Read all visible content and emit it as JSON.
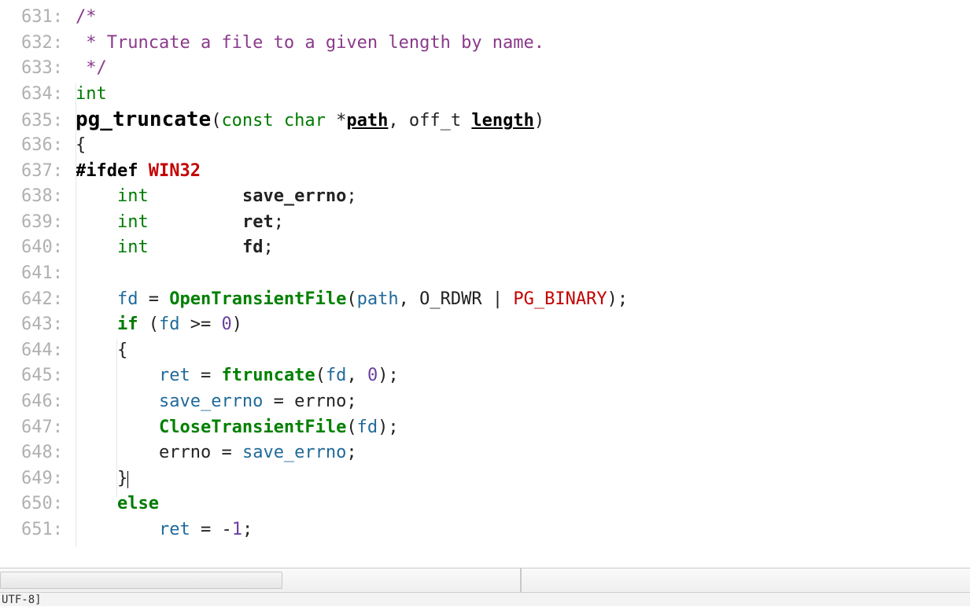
{
  "editor": {
    "first_line_number": 631,
    "encoding_status": "UTF-8]",
    "cursor_line_index": 18,
    "lines": [
      {
        "n": "631",
        "tokens": [
          {
            "cls": "c-comment",
            "t": "/*"
          }
        ]
      },
      {
        "n": "632",
        "tokens": [
          {
            "cls": "c-comment",
            "t": " * Truncate a file to a given length by name."
          }
        ]
      },
      {
        "n": "633",
        "tokens": [
          {
            "cls": "c-comment",
            "t": " */"
          }
        ]
      },
      {
        "n": "634",
        "tokens": [
          {
            "cls": "c-keyword-plain",
            "t": "int"
          }
        ]
      },
      {
        "n": "635",
        "tokens": [
          {
            "cls": "c-funcdef",
            "t": "pg_truncate"
          },
          {
            "cls": "c-brace",
            "t": "("
          },
          {
            "cls": "c-keyword-plain",
            "t": "const"
          },
          {
            "cls": "",
            "t": " "
          },
          {
            "cls": "c-keyword-plain",
            "t": "char"
          },
          {
            "cls": "",
            "t": " "
          },
          {
            "cls": "c-op",
            "t": "*"
          },
          {
            "cls": "c-param",
            "t": "path"
          },
          {
            "cls": "c-op",
            "t": ","
          },
          {
            "cls": "",
            "t": " "
          },
          {
            "cls": "c-ident",
            "t": "off_t"
          },
          {
            "cls": "",
            "t": " "
          },
          {
            "cls": "c-param",
            "t": "length"
          },
          {
            "cls": "c-brace",
            "t": ")"
          }
        ]
      },
      {
        "n": "636",
        "tokens": [
          {
            "cls": "c-brace",
            "t": "{"
          }
        ]
      },
      {
        "n": "637",
        "tokens": [
          {
            "cls": "c-preproc",
            "t": "#ifdef"
          },
          {
            "cls": "",
            "t": " "
          },
          {
            "cls": "c-preproc-id",
            "t": "WIN32"
          }
        ]
      },
      {
        "n": "638",
        "tokens": [
          {
            "cls": "",
            "t": "    "
          },
          {
            "cls": "c-keyword-plain",
            "t": "int"
          },
          {
            "cls": "",
            "t": "         "
          },
          {
            "cls": "c-var-bold",
            "t": "save_errno"
          },
          {
            "cls": "c-op",
            "t": ";"
          }
        ]
      },
      {
        "n": "639",
        "tokens": [
          {
            "cls": "",
            "t": "    "
          },
          {
            "cls": "c-keyword-plain",
            "t": "int"
          },
          {
            "cls": "",
            "t": "         "
          },
          {
            "cls": "c-var-bold",
            "t": "ret"
          },
          {
            "cls": "c-op",
            "t": ";"
          }
        ]
      },
      {
        "n": "640",
        "tokens": [
          {
            "cls": "",
            "t": "    "
          },
          {
            "cls": "c-keyword-plain",
            "t": "int"
          },
          {
            "cls": "",
            "t": "         "
          },
          {
            "cls": "c-var-bold",
            "t": "fd"
          },
          {
            "cls": "c-op",
            "t": ";"
          }
        ]
      },
      {
        "n": "641",
        "tokens": []
      },
      {
        "n": "642",
        "tokens": [
          {
            "cls": "",
            "t": "    "
          },
          {
            "cls": "c-var",
            "t": "fd"
          },
          {
            "cls": "",
            "t": " "
          },
          {
            "cls": "c-op",
            "t": "="
          },
          {
            "cls": "",
            "t": " "
          },
          {
            "cls": "c-funcname",
            "t": "OpenTransientFile"
          },
          {
            "cls": "c-brace",
            "t": "("
          },
          {
            "cls": "c-var",
            "t": "path"
          },
          {
            "cls": "c-op",
            "t": ","
          },
          {
            "cls": "",
            "t": " "
          },
          {
            "cls": "c-ident",
            "t": "O_RDWR"
          },
          {
            "cls": "",
            "t": " "
          },
          {
            "cls": "c-op",
            "t": "|"
          },
          {
            "cls": "",
            "t": " "
          },
          {
            "cls": "c-macro",
            "t": "PG_BINARY"
          },
          {
            "cls": "c-brace",
            "t": ")"
          },
          {
            "cls": "c-op",
            "t": ";"
          }
        ]
      },
      {
        "n": "643",
        "tokens": [
          {
            "cls": "",
            "t": "    "
          },
          {
            "cls": "c-keyword",
            "t": "if"
          },
          {
            "cls": "",
            "t": " "
          },
          {
            "cls": "c-brace",
            "t": "("
          },
          {
            "cls": "c-var",
            "t": "fd"
          },
          {
            "cls": "",
            "t": " "
          },
          {
            "cls": "c-op",
            "t": ">="
          },
          {
            "cls": "",
            "t": " "
          },
          {
            "cls": "c-number",
            "t": "0"
          },
          {
            "cls": "c-brace",
            "t": ")"
          }
        ]
      },
      {
        "n": "644",
        "tokens": [
          {
            "cls": "",
            "t": "    "
          },
          {
            "cls": "c-brace",
            "t": "{"
          }
        ]
      },
      {
        "n": "645",
        "tokens": [
          {
            "cls": "",
            "t": "        "
          },
          {
            "cls": "c-var",
            "t": "ret"
          },
          {
            "cls": "",
            "t": " "
          },
          {
            "cls": "c-op",
            "t": "="
          },
          {
            "cls": "",
            "t": " "
          },
          {
            "cls": "c-funcname",
            "t": "ftruncate"
          },
          {
            "cls": "c-brace",
            "t": "("
          },
          {
            "cls": "c-var",
            "t": "fd"
          },
          {
            "cls": "c-op",
            "t": ","
          },
          {
            "cls": "",
            "t": " "
          },
          {
            "cls": "c-number",
            "t": "0"
          },
          {
            "cls": "c-brace",
            "t": ")"
          },
          {
            "cls": "c-op",
            "t": ";"
          }
        ]
      },
      {
        "n": "646",
        "tokens": [
          {
            "cls": "",
            "t": "        "
          },
          {
            "cls": "c-var",
            "t": "save_errno"
          },
          {
            "cls": "",
            "t": " "
          },
          {
            "cls": "c-op",
            "t": "="
          },
          {
            "cls": "",
            "t": " "
          },
          {
            "cls": "c-ident",
            "t": "errno"
          },
          {
            "cls": "c-op",
            "t": ";"
          }
        ]
      },
      {
        "n": "647",
        "tokens": [
          {
            "cls": "",
            "t": "        "
          },
          {
            "cls": "c-funcname",
            "t": "CloseTransientFile"
          },
          {
            "cls": "c-brace",
            "t": "("
          },
          {
            "cls": "c-var",
            "t": "fd"
          },
          {
            "cls": "c-brace",
            "t": ")"
          },
          {
            "cls": "c-op",
            "t": ";"
          }
        ]
      },
      {
        "n": "648",
        "tokens": [
          {
            "cls": "",
            "t": "        "
          },
          {
            "cls": "c-ident",
            "t": "errno"
          },
          {
            "cls": "",
            "t": " "
          },
          {
            "cls": "c-op",
            "t": "="
          },
          {
            "cls": "",
            "t": " "
          },
          {
            "cls": "c-var",
            "t": "save_errno"
          },
          {
            "cls": "c-op",
            "t": ";"
          }
        ]
      },
      {
        "n": "649",
        "tokens": [
          {
            "cls": "",
            "t": "    "
          },
          {
            "cls": "c-brace",
            "t": "}"
          },
          {
            "cls": "caret-marker",
            "t": ""
          }
        ]
      },
      {
        "n": "650",
        "tokens": [
          {
            "cls": "",
            "t": "    "
          },
          {
            "cls": "c-keyword",
            "t": "else"
          }
        ]
      },
      {
        "n": "651",
        "tokens": [
          {
            "cls": "",
            "t": "        "
          },
          {
            "cls": "c-var",
            "t": "ret"
          },
          {
            "cls": "",
            "t": " "
          },
          {
            "cls": "c-op",
            "t": "="
          },
          {
            "cls": "",
            "t": " "
          },
          {
            "cls": "c-op",
            "t": "-"
          },
          {
            "cls": "c-number",
            "t": "1"
          },
          {
            "cls": "c-op",
            "t": ";"
          }
        ]
      }
    ]
  }
}
